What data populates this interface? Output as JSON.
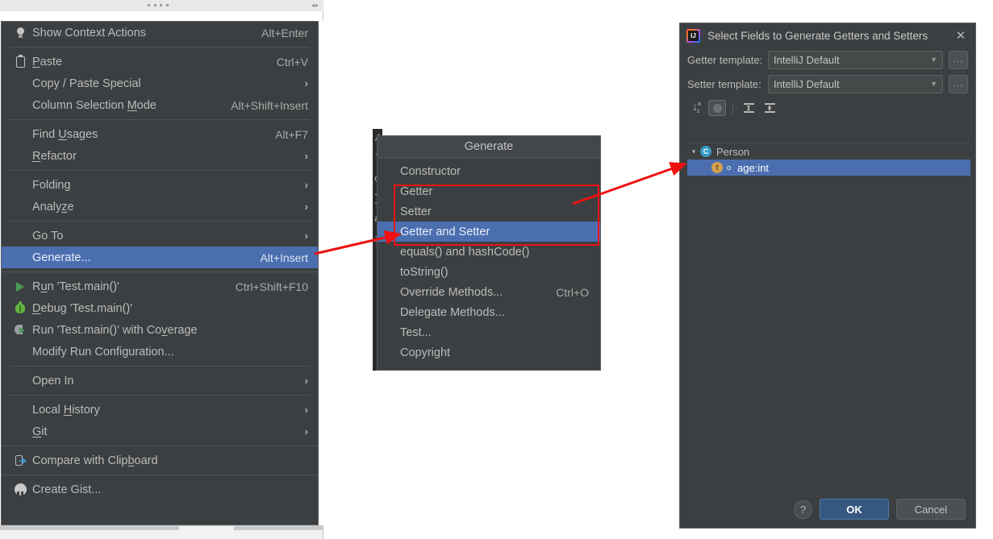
{
  "top_strip": {
    "handle_icon": "drag-dots-icon",
    "arrows_icon": "collapse-arrows-icon"
  },
  "context_menu": {
    "groups": [
      {
        "items": [
          {
            "label": "Show Context Actions",
            "accel": "Alt+Enter",
            "icon": "lightbulb-icon",
            "arrow": "",
            "selected": false
          }
        ]
      },
      {
        "items": [
          {
            "label": "Paste",
            "mnemonic": "P",
            "accel": "Ctrl+V",
            "icon": "clipboard-icon",
            "arrow": "",
            "selected": false
          },
          {
            "label": "Copy / Paste Special",
            "accel": "",
            "icon": "",
            "arrow": "›",
            "selected": false
          },
          {
            "label": "Column Selection Mode",
            "mnemonic": "M",
            "accel": "Alt+Shift+Insert",
            "icon": "",
            "arrow": "",
            "selected": false
          }
        ]
      },
      {
        "items": [
          {
            "label": "Find Usages",
            "mnemonic": "U",
            "accel": "Alt+F7",
            "icon": "",
            "arrow": "",
            "selected": false
          },
          {
            "label": "Refactor",
            "mnemonic": "R",
            "accel": "",
            "icon": "",
            "arrow": "›",
            "selected": false
          }
        ]
      },
      {
        "items": [
          {
            "label": "Folding",
            "accel": "",
            "icon": "",
            "arrow": "›",
            "selected": false
          },
          {
            "label": "Analyze",
            "mnemonic": "z",
            "accel": "",
            "icon": "",
            "arrow": "›",
            "selected": false
          }
        ]
      },
      {
        "items": [
          {
            "label": "Go To",
            "accel": "",
            "icon": "",
            "arrow": "›",
            "selected": false
          },
          {
            "label": "Generate...",
            "accel": "Alt+Insert",
            "icon": "",
            "arrow": "",
            "selected": true
          }
        ]
      },
      {
        "items": [
          {
            "label": "Run 'Test.main()'",
            "mnemonic": "u",
            "accel": "Ctrl+Shift+F10",
            "icon": "run-icon",
            "arrow": "",
            "selected": false
          },
          {
            "label": "Debug 'Test.main()'",
            "mnemonic": "D",
            "accel": "",
            "icon": "debug-icon",
            "arrow": "",
            "selected": false
          },
          {
            "label": "Run 'Test.main()' with Coverage",
            "mnemonic": "v",
            "accel": "",
            "icon": "coverage-icon",
            "arrow": "",
            "selected": false
          },
          {
            "label": "Modify Run Configuration...",
            "accel": "",
            "icon": "",
            "arrow": "",
            "selected": false
          }
        ]
      },
      {
        "items": [
          {
            "label": "Open In",
            "accel": "",
            "icon": "",
            "arrow": "›",
            "selected": false
          }
        ]
      },
      {
        "items": [
          {
            "label": "Local History",
            "mnemonic": "H",
            "accel": "",
            "icon": "",
            "arrow": "›",
            "selected": false
          },
          {
            "label": "Git",
            "mnemonic": "G",
            "accel": "",
            "icon": "",
            "arrow": "›",
            "selected": false
          }
        ]
      },
      {
        "items": [
          {
            "label": "Compare with Clipboard",
            "mnemonic": "b",
            "accel": "",
            "icon": "compare-clipboard-icon",
            "arrow": "",
            "selected": false
          }
        ]
      },
      {
        "items": [
          {
            "label": "Create Gist...",
            "accel": "",
            "icon": "github-icon",
            "arrow": "",
            "selected": false
          }
        ]
      }
    ]
  },
  "editor_sliver": {
    "lines": [
      "/",
      "l",
      "o",
      "",
      "}",
      "",
      "",
      "",
      "a",
      "i"
    ]
  },
  "generate_popup": {
    "title": "Generate",
    "items": [
      {
        "label": "Constructor",
        "accel": "",
        "selected": false
      },
      {
        "label": "Getter",
        "accel": "",
        "selected": false
      },
      {
        "label": "Setter",
        "accel": "",
        "selected": false
      },
      {
        "label": "Getter and Setter",
        "accel": "",
        "selected": true
      },
      {
        "label": "equals() and hashCode()",
        "accel": "",
        "selected": false
      },
      {
        "label": "toString()",
        "accel": "",
        "selected": false
      },
      {
        "label": "Override Methods...",
        "accel": "Ctrl+O",
        "selected": false
      },
      {
        "label": "Delegate Methods...",
        "accel": "",
        "selected": false
      },
      {
        "label": "Test...",
        "accel": "",
        "selected": false
      },
      {
        "label": "Copyright",
        "accel": "",
        "selected": false
      }
    ],
    "highlight_box_color": "#ee1111"
  },
  "dialog": {
    "title": "Select Fields to Generate Getters and Setters",
    "logo_icon": "intellij-idea-logo-icon",
    "close_icon": "close-icon",
    "getter_template": {
      "label": "Getter template:",
      "value": "IntelliJ Default",
      "browse_label": "..."
    },
    "setter_template": {
      "label": "Setter template:",
      "value": "IntelliJ Default",
      "browse_label": "..."
    },
    "toolbar": [
      {
        "name": "sort-alphabetically-icon",
        "glyph": "↓ᵃᶬ",
        "pressed": false
      },
      {
        "name": "toggle-circle-icon",
        "glyph": "",
        "pressed": true
      },
      {
        "name": "expand-all-icon",
        "glyph": "",
        "pressed": false
      },
      {
        "name": "collapse-all-icon",
        "glyph": "",
        "pressed": false
      }
    ],
    "tree": [
      {
        "label": "Person",
        "kind": "class",
        "badge": "C",
        "chevron": "⌄",
        "indent": 0,
        "selected": false
      },
      {
        "label": "age:int",
        "kind": "field",
        "badge": "f",
        "chevron": "",
        "indent": 1,
        "selected": true
      }
    ],
    "buttons": {
      "help": "?",
      "ok": "OK",
      "cancel": "Cancel"
    }
  },
  "colors": {
    "selection_blue": "#4b6eaf",
    "panel_bg": "#3c3f41",
    "annotation_red": "#ee1111",
    "ok_button": "#365880"
  }
}
